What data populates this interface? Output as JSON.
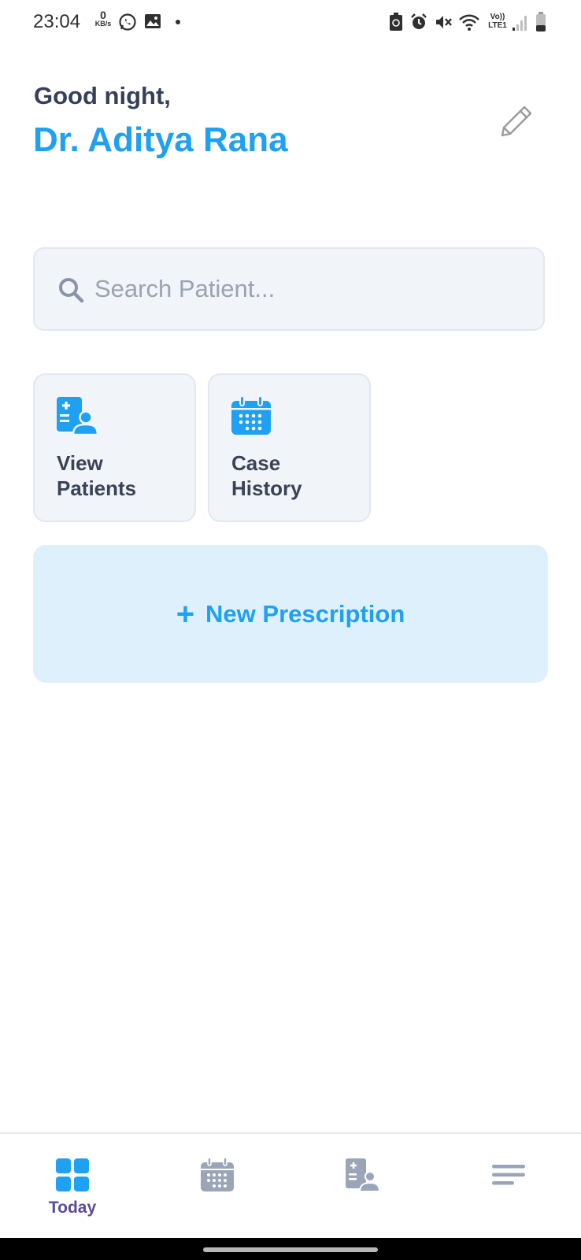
{
  "status_bar": {
    "time": "23:04",
    "data_speed_value": "0",
    "data_speed_unit": "KB/s",
    "network_label_top": "Vo))",
    "network_label_bottom": "LTE1",
    "icons": [
      "whatsapp-icon",
      "gallery-icon",
      "dot-icon",
      "battery-saver-icon",
      "alarm-icon",
      "mute-icon",
      "wifi-icon",
      "signal-icon",
      "battery-icon"
    ]
  },
  "header": {
    "greeting": "Good night,",
    "doctor_name": "Dr. Aditya Rana",
    "edit_icon": "pencil-icon"
  },
  "search": {
    "placeholder": "Search Patient...",
    "value": "",
    "icon": "search-icon"
  },
  "tiles": [
    {
      "line1": "View",
      "line2": "Patients",
      "icon": "patient-card-icon"
    },
    {
      "line1": "Case",
      "line2": "History",
      "icon": "calendar-icon"
    }
  ],
  "new_prescription": {
    "plus": "+",
    "label": "New Prescription"
  },
  "bottom_nav": {
    "items": [
      {
        "label": "Today",
        "icon": "dashboard-grid-icon",
        "active": true
      },
      {
        "label": "",
        "icon": "calendar-icon",
        "active": false
      },
      {
        "label": "",
        "icon": "patient-card-icon",
        "active": false
      },
      {
        "label": "",
        "icon": "menu-icon",
        "active": false
      }
    ]
  },
  "colors": {
    "accent": "#1ea1f2",
    "greeting_text": "#34405a",
    "card_bg": "#f1f4f9",
    "card_border": "#e2e8f0",
    "prescription_bg": "#dff0fd",
    "nav_inactive": "#9aa5b8",
    "nav_active_label": "#5b4b9c"
  }
}
